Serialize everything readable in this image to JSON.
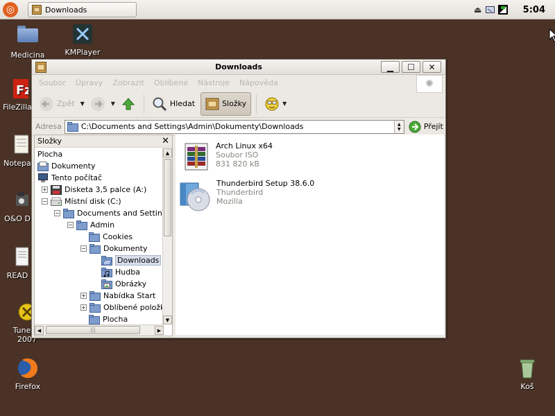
{
  "top_panel": {
    "taskbar_item": "Downloads",
    "clock": "5:04"
  },
  "desktop": {
    "icons": [
      {
        "label": "Medicina",
        "icon": "folder-icon"
      },
      {
        "label": "KMPlayer",
        "icon": "kmplayer-icon"
      },
      {
        "label": "FileZilla",
        "icon": "filezilla-icon"
      },
      {
        "label": "Notepa",
        "icon": "notepad-icon"
      },
      {
        "label": "O&O D",
        "icon": "oo-defrag-icon"
      },
      {
        "label": "READ",
        "icon": "readme-icon"
      },
      {
        "label": "TuneUp",
        "label2": "2007",
        "icon": "tuneup-icon"
      },
      {
        "label": "Firefox",
        "icon": "firefox-icon"
      },
      {
        "label": "Koš",
        "icon": "trash-icon"
      }
    ]
  },
  "window": {
    "title": "Downloads",
    "menu": [
      "Soubor",
      "Úpravy",
      "Zobrazit",
      "Oblíbené",
      "Nástroje",
      "Nápověda"
    ],
    "toolbar": {
      "back": "Zpět",
      "search": "Hledat",
      "folders": "Složky"
    },
    "address": {
      "label": "Adresa",
      "path": "C:\\Documents and Settings\\Admin\\Dokumenty\\Downloads",
      "go": "Přejít"
    },
    "folders_pane": {
      "title": "Složky",
      "tree": [
        {
          "label": "Plocha",
          "icon": "none",
          "expander": ""
        },
        {
          "label": "Dokumenty",
          "icon": "documents-icon",
          "expander": ""
        },
        {
          "label": "Tento počítač",
          "icon": "computer-icon",
          "expander": ""
        },
        {
          "label": "Disketa 3,5 palce (A:)",
          "icon": "floppy-icon",
          "expander": "+"
        },
        {
          "label": "Místní disk (C:)",
          "icon": "drive-icon",
          "expander": "−"
        },
        {
          "label": "Documents and Settings",
          "icon": "folder-icon",
          "expander": "−"
        },
        {
          "label": "Admin",
          "icon": "folder-icon",
          "expander": "−"
        },
        {
          "label": "Cookies",
          "icon": "folder-icon",
          "expander": ""
        },
        {
          "label": "Dokumenty",
          "icon": "folder-icon",
          "expander": "−"
        },
        {
          "label": "Downloads",
          "icon": "folder-open-icon",
          "expander": "",
          "selected": true
        },
        {
          "label": "Hudba",
          "icon": "music-folder-icon",
          "expander": ""
        },
        {
          "label": "Obrázky",
          "icon": "pictures-folder-icon",
          "expander": ""
        },
        {
          "label": "Nabídka Start",
          "icon": "folder-icon",
          "expander": "+"
        },
        {
          "label": "Oblíbené položky",
          "icon": "folder-icon",
          "expander": "+"
        },
        {
          "label": "Plocha",
          "icon": "folder-icon",
          "expander": ""
        }
      ]
    },
    "files": [
      {
        "name": "Arch Linux x64",
        "type": "Soubor ISO",
        "detail": "831 820 kB",
        "icon": "winrar-archive-icon"
      },
      {
        "name": "Thunderbird Setup 38.6.0",
        "type": "Thunderbird",
        "detail": "Mozilla",
        "icon": "installer-cd-icon"
      }
    ]
  }
}
